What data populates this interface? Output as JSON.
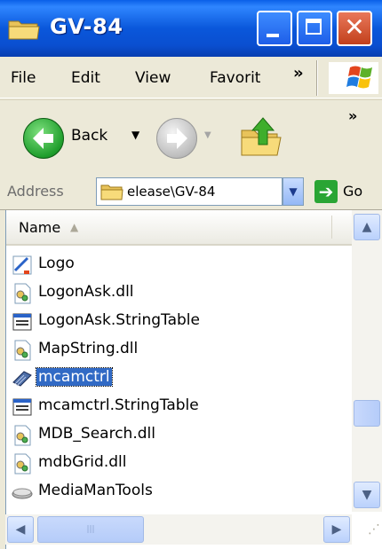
{
  "window": {
    "title": "GV-84",
    "close_symbol": "✕"
  },
  "menubar": {
    "items": [
      "File",
      "Edit",
      "View",
      "Favorit"
    ],
    "chevron": "»"
  },
  "toolbar": {
    "back_label": "Back",
    "chevron": "»"
  },
  "address": {
    "label": "Address",
    "value": "elease\\GV-84",
    "go_label": "Go"
  },
  "list": {
    "column_header": "Name",
    "items": [
      {
        "name": "Logo",
        "icon": "shortcut-icon",
        "selected": false
      },
      {
        "name": "LogonAsk.dll",
        "icon": "dll-file-icon",
        "selected": false
      },
      {
        "name": "LogonAsk.StringTable",
        "icon": "stringtable-file-icon",
        "selected": false
      },
      {
        "name": "MapString.dll",
        "icon": "dll-file-icon",
        "selected": false
      },
      {
        "name": "mcamctrl",
        "icon": "activex-control-icon",
        "selected": true
      },
      {
        "name": "mcamctrl.StringTable",
        "icon": "stringtable-file-icon",
        "selected": false
      },
      {
        "name": "MDB_Search.dll",
        "icon": "dll-file-icon",
        "selected": false
      },
      {
        "name": "mdbGrid.dll",
        "icon": "dll-file-icon",
        "selected": false
      },
      {
        "name": "MediaManTools",
        "icon": "application-icon",
        "selected": false
      }
    ]
  },
  "colors": {
    "titlebar": "#0A57DB",
    "selection": "#316AC5",
    "close_button": "#C2401C"
  }
}
